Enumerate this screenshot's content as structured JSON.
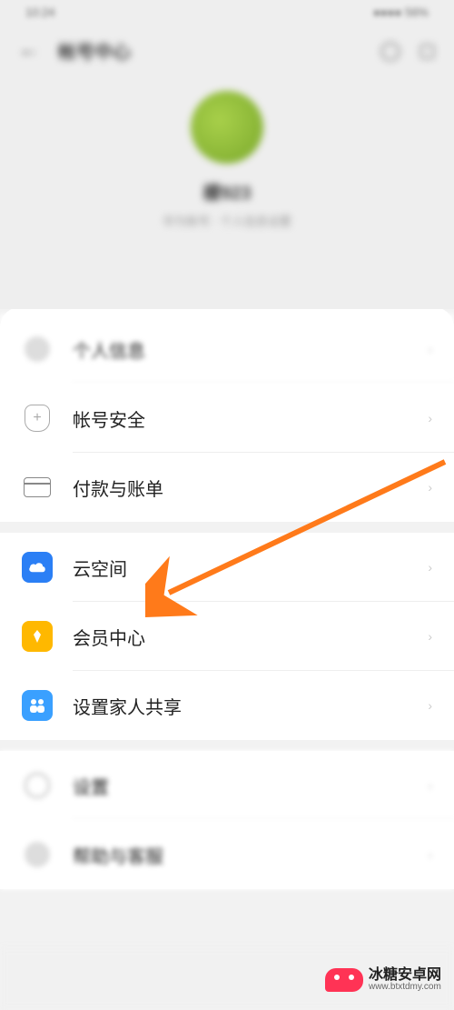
{
  "status": {
    "left": "10:24",
    "right": "●●●● 56%"
  },
  "nav": {
    "title": "帐号中心"
  },
  "profile": {
    "username": "檬923",
    "subtitle": "华为账号 · 个人信息设置"
  },
  "rows": {
    "personal": "个人信息",
    "security": "帐号安全",
    "payment": "付款与账单",
    "cloud": "云空间",
    "member": "会员中心",
    "family": "设置家人共享",
    "settings": "设置",
    "help": "帮助与客服"
  },
  "watermark": {
    "name": "冰糖安卓网",
    "url": "www.btxtdmy.com"
  }
}
